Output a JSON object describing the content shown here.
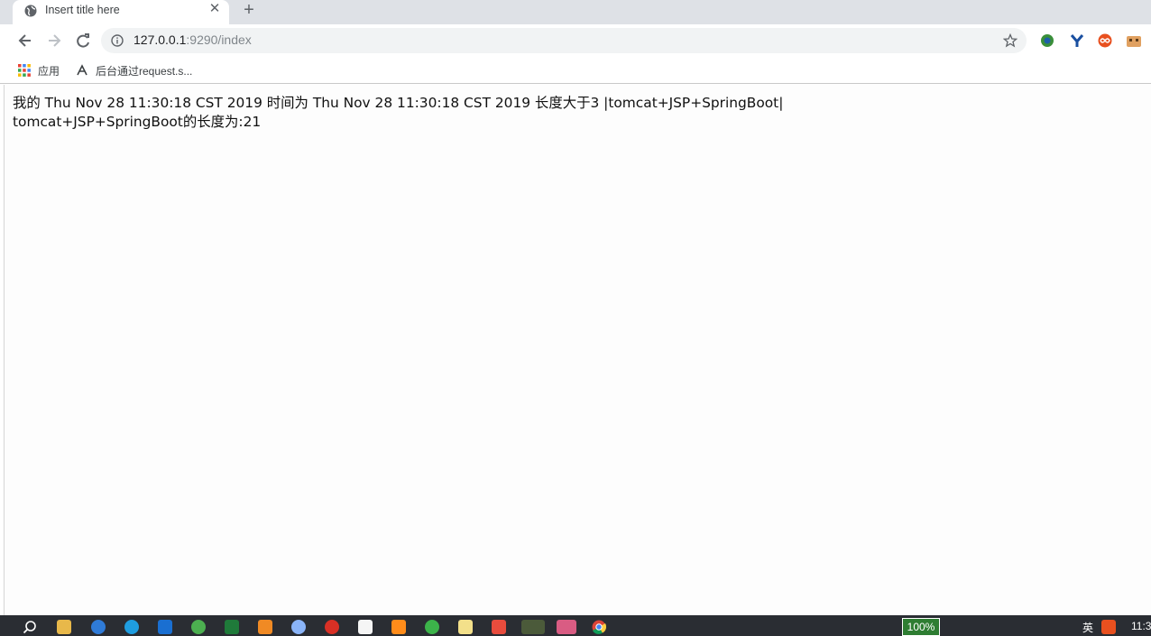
{
  "browser": {
    "tab": {
      "title": "Insert title here",
      "close_glyph": "✕",
      "favicon": "globe-icon"
    },
    "new_tab_glyph": "+",
    "nav": {
      "back": "arrow-left-icon",
      "forward": "arrow-right-icon",
      "reload": "reload-icon"
    },
    "omnibox": {
      "host": "127.0.0.1",
      "path": ":9290/index",
      "info_icon": "info-icon",
      "star_icon": "star-icon"
    },
    "extensions": [
      "extension-globe-icon",
      "extension-y-icon",
      "extension-infinity-icon",
      "extension-folder-icon"
    ],
    "bookmarks": [
      {
        "label": "应用",
        "icon": "apps-grid-icon"
      },
      {
        "label": "后台通过request.s...",
        "icon": "bookmark-page-icon"
      }
    ]
  },
  "page": {
    "line1": "我的 Thu Nov 28 11:30:18 CST 2019 时间为 Thu Nov 28 11:30:18 CST 2019 长度大于3 |tomcat+JSP+SpringBoot|",
    "line2": "tomcat+JSP+SpringBoot的长度为:21"
  },
  "taskbar": {
    "apps": [
      "search-icon",
      "file-explorer-icon",
      "sogou-icon",
      "edge-icon",
      "maps-icon",
      "clover-icon",
      "excel-icon",
      "sublime-icon",
      "magnifier-icon",
      "app-red-icon",
      "typora-icon",
      "intellij-icon",
      "leaf-icon",
      "notes-icon",
      "app-colorful-icon",
      "wechat-icon",
      "app-pink-icon",
      "chrome-icon"
    ],
    "battery": "100%",
    "ime": "英",
    "clock": "11:3"
  },
  "colors": {
    "tabstrip": "#dee1e6",
    "taskbar": "#2a2d33",
    "battery": "#2e7d32"
  }
}
